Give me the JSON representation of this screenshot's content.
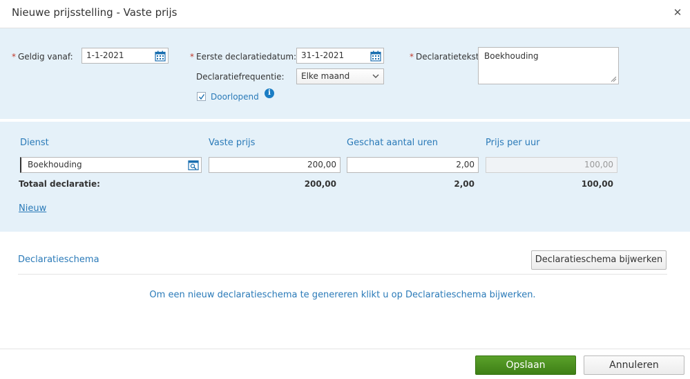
{
  "dialog": {
    "title": "Nieuwe prijsstelling - Vaste prijs",
    "close_icon": "close-icon"
  },
  "form": {
    "required_marker": "*",
    "geldig_vanaf": {
      "label": "Geldig vanaf:",
      "value": "1-1-2021"
    },
    "eerste_declaratiedatum": {
      "label": "Eerste declaratiedatum:",
      "value": "31-1-2021"
    },
    "declaratiefrequentie": {
      "label": "Declaratiefrequentie:",
      "value": "Elke maand"
    },
    "doorlopend": {
      "label": "Doorlopend",
      "checked": true
    },
    "declaratietekst": {
      "label": "Declaratietekst:",
      "value": "Boekhouding"
    }
  },
  "services": {
    "columns": {
      "dienst": "Dienst",
      "vaste_prijs": "Vaste prijs",
      "geschat_aantal_uren": "Geschat aantal uren",
      "prijs_per_uur": "Prijs per uur"
    },
    "row": {
      "dienst": "Boekhouding",
      "vaste_prijs": "200,00",
      "geschat_aantal_uren": "2,00",
      "prijs_per_uur": "100,00"
    },
    "totals": {
      "label": "Totaal declaratie:",
      "vaste_prijs": "200,00",
      "geschat_aantal_uren": "2,00",
      "prijs_per_uur": "100,00"
    },
    "new_link": "Nieuw"
  },
  "schema": {
    "title": "Declaratieschema",
    "update_button": "Declaratieschema bijwerken",
    "message": "Om een nieuw declaratieschema te genereren klikt u op Declaratieschema bijwerken."
  },
  "footer": {
    "save_button": "Opslaan",
    "cancel_button": "Annuleren"
  },
  "colors": {
    "panel_bg": "#e5f1f9",
    "accent_blue": "#2a7ab8",
    "save_green": "#4a8f1f",
    "required_red": "#c0392b"
  },
  "icons": {
    "calendar": "calendar-icon",
    "search": "search-icon",
    "chevron_down": "chevron-down-icon",
    "info": "info-icon",
    "checkmark": "checkmark-icon"
  }
}
